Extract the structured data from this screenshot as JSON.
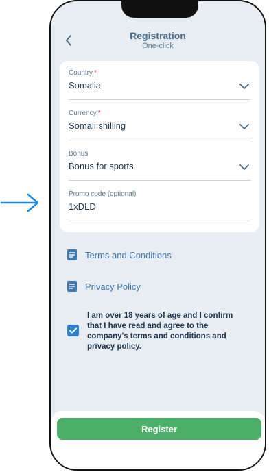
{
  "header": {
    "title": "Registration",
    "subtitle": "One-click",
    "back_icon": "chevron-left-icon"
  },
  "form": {
    "required_marker": "*",
    "country": {
      "label": "Country",
      "value": "Somalia",
      "required": true
    },
    "currency": {
      "label": "Currency",
      "value": "Somali shilling",
      "required": true
    },
    "bonus": {
      "label": "Bonus",
      "value": "Bonus for sports"
    },
    "promo": {
      "label": "Promo code (optional)",
      "value": "1xDLD"
    }
  },
  "links": {
    "terms": "Terms and Conditions",
    "privacy": "Privacy Policy"
  },
  "consent": {
    "checked": true,
    "text": "I am over 18 years of age and I confirm that I have read and agree to the company's terms and conditions and privacy policy."
  },
  "footer": {
    "register_label": "Register"
  },
  "colors": {
    "accent": "#2f7fd0",
    "register_button": "#4caf68",
    "link": "#3e79ad",
    "required": "#d93a3a",
    "background": "#e8edf3"
  }
}
